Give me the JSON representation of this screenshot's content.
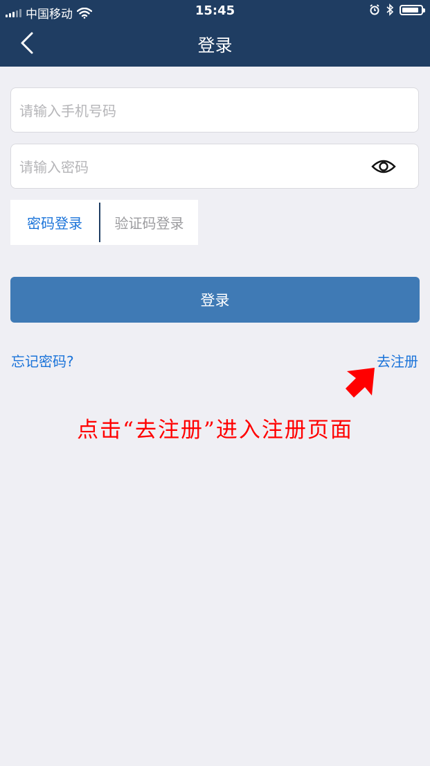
{
  "status_bar": {
    "carrier": "中国移动",
    "time": "15:45",
    "battery_level": 0.9
  },
  "nav": {
    "title": "登录"
  },
  "form": {
    "phone_placeholder": "请输入手机号码",
    "phone_value": "",
    "password_placeholder": "请输入密码",
    "password_value": "",
    "tabs": [
      {
        "label": "密码登录",
        "active": true
      },
      {
        "label": "验证码登录",
        "active": false
      }
    ],
    "login_label": "登录",
    "forgot_label": "忘记密码?",
    "register_label": "去注册"
  },
  "annotation": {
    "text": "点击“去注册”进入注册页面",
    "color": "#ff0000"
  },
  "colors": {
    "header_bg": "#1f3d62",
    "page_bg": "#efeff4",
    "primary_button": "#3f7ab5",
    "link": "#1a73d9"
  }
}
